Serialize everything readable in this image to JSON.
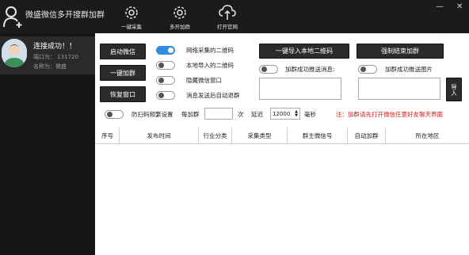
{
  "app": {
    "title": "微盛微信多开搜群加群"
  },
  "toolbar": {
    "collect_label": "一键采集",
    "multi_label": "多开加群",
    "open_site_label": "打开官网"
  },
  "account": {
    "status": "连接成功！！",
    "port_line": "端口为：  131720",
    "name_line": "名称为：微盛"
  },
  "left_buttons": {
    "start_wechat": "启动微信",
    "one_click_join": "一键加群",
    "restore_window": "恢复窗口"
  },
  "options": {
    "network_qr": "网络采集的二维码",
    "local_qr": "本地导入的二维码",
    "hide_wechat": "隐藏微信窗口",
    "auto_quit": "消息发送后自动退群"
  },
  "actions": {
    "import_local_qr": "一键导入本地二维码",
    "force_stop": "强制结束加群",
    "join_success_msg": "加群成功推送消息:",
    "join_success_img": "加群成功推送图片",
    "import_label": "导入"
  },
  "settings": {
    "anti_scan_label": "防扫码频繁设置",
    "per_join_label": "每加群",
    "per_join_value": "",
    "times_label": "次",
    "delay_label": "延迟",
    "delay_value": "12000",
    "ms_label": "毫秒",
    "notice": "注：加群请先打开微信任意好友聊天界面"
  },
  "table": {
    "columns": [
      "序号",
      "发布时间",
      "行业分类",
      "采集类型",
      "群主微信号",
      "自动加群",
      "所在地区"
    ]
  },
  "colors": {
    "titlebar": "#1b1b1b",
    "toggle_on": "#2f8ce0",
    "notice": "#d41919"
  }
}
